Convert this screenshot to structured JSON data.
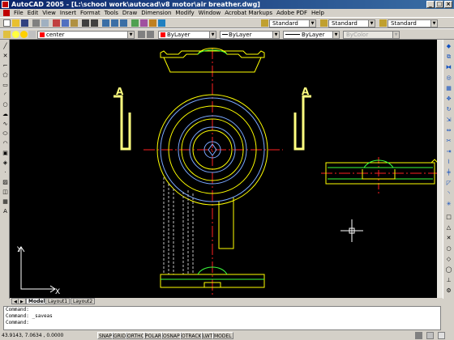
{
  "titlebar": {
    "title": "AutoCAD 2005 - [L:\\school work\\autocad\\v8 motor\\air breather.dwg]"
  },
  "menu": [
    "File",
    "Edit",
    "View",
    "Insert",
    "Format",
    "Tools",
    "Draw",
    "Dimension",
    "Modify",
    "Window",
    "Acrobat Markups",
    "Adobe PDF",
    "Help"
  ],
  "toolbar": {
    "text_style": "Standard",
    "dim_style": "Standard",
    "table_style": "Standard",
    "layer": "center",
    "color": "ByLayer",
    "linetype": "ByLayer",
    "lineweight": "ByLayer",
    "plotstyle": "ByColor"
  },
  "drawing": {
    "section_label_left": "A",
    "section_label_right": "A",
    "ucs_y": "Y",
    "ucs_x": "X"
  },
  "tabs": [
    "Model",
    "Layout1",
    "Layout2"
  ],
  "command": {
    "lines": [
      "Command:",
      "Command: _saveas",
      "Command:"
    ]
  },
  "status": {
    "coords": "43.9143, 7.0634 , 0.0000",
    "buttons": [
      "SNAP",
      "GRID",
      "ORTHO",
      "POLAR",
      "OSNAP",
      "OTRACK",
      "LWT",
      "MODEL"
    ]
  },
  "colors": {
    "yellow": "#ffff00",
    "blue": "#7aa7ff",
    "green": "#3dff3d",
    "red": "#ff2020",
    "label": "#ffff80"
  }
}
